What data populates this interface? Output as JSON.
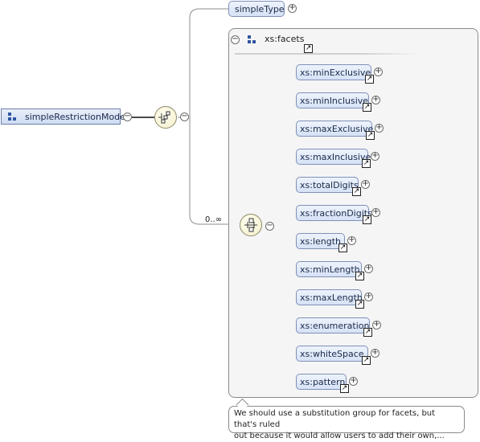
{
  "root": {
    "label": "simpleRestrictionModel",
    "icon": "element-grid-icon"
  },
  "simple_type": {
    "label": "simpleType"
  },
  "group": {
    "label": "xs:facets",
    "icon": "group-grid-icon"
  },
  "occurrence": "0..∞",
  "facets": [
    {
      "label": "xs:minExclusive"
    },
    {
      "label": "xs:minInclusive"
    },
    {
      "label": "xs:maxExclusive"
    },
    {
      "label": "xs:maxInclusive"
    },
    {
      "label": "xs:totalDigits"
    },
    {
      "label": "xs:fractionDigits"
    },
    {
      "label": "xs:length"
    },
    {
      "label": "xs:minLength"
    },
    {
      "label": "xs:maxLength"
    },
    {
      "label": "xs:enumeration"
    },
    {
      "label": "xs:whiteSpace"
    },
    {
      "label": "xs:pattern"
    }
  ],
  "comment": "We should use a substitution group for facets, but that's ruled\nout because it would allow users to add their own,...",
  "symbols": {
    "expand": "+",
    "collapse": "−",
    "reference": "↗"
  },
  "colors": {
    "node_fill": "#dde7f7",
    "node_border": "#7f90b8",
    "compositor_fill": "#f8f5dc",
    "group_fill": "#f5f5f5",
    "icon_blue": "#2f56a0"
  }
}
